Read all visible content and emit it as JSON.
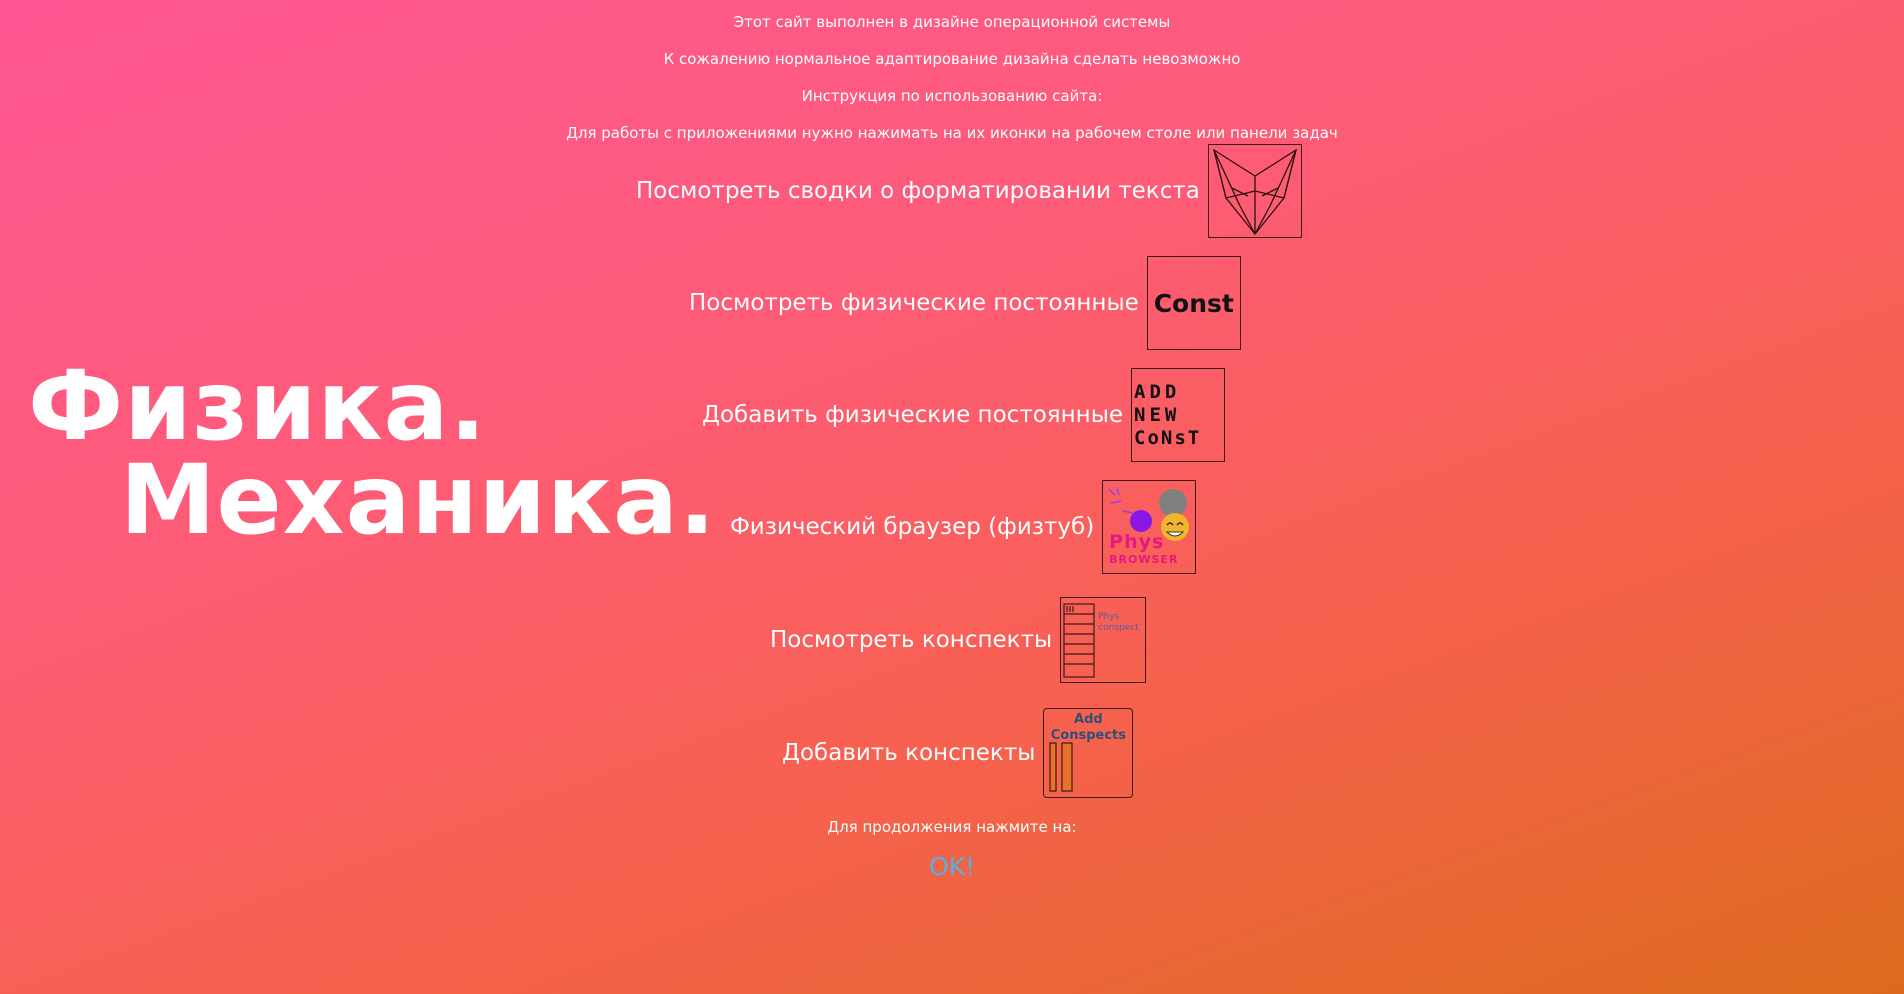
{
  "intro": {
    "line1": "Этот сайт выполнен в дизайне операционной системы",
    "line2": "К сожалению нормальное адаптирование дизайна сделать невозможно",
    "line3": "Инструкция по использованию сайта:",
    "line4": "Для работы с приложениями нужно нажимать на их иконки на рабочем столе или панели задач"
  },
  "hero": {
    "line1": "Физика.",
    "line2": "Механика."
  },
  "apps": [
    {
      "label": "Посмотреть сводки о форматировании текста",
      "icon": "fox-logo-icon"
    },
    {
      "label": "Посмотреть физические постоянные",
      "icon": "const-icon",
      "icon_text": "Const"
    },
    {
      "label": "Добавить физические постоянные",
      "icon": "add-new-const-icon",
      "icon_lines": [
        "ADD",
        "NEW",
        "CoNsT"
      ]
    },
    {
      "label": "Физический браузер (физтуб)",
      "icon": "phys-browser-icon",
      "icon_lines": [
        "Phys",
        "BROWSER"
      ]
    },
    {
      "label": "Посмотреть конспекты",
      "icon": "phys-conspect-icon",
      "icon_lines": [
        "Phys",
        "conspect"
      ]
    },
    {
      "label": "Добавить конспекты",
      "icon": "add-conspects-icon",
      "icon_lines": [
        "Add",
        "Conspects"
      ]
    }
  ],
  "footer": {
    "continue_text": "Для продолжения нажмите на:",
    "ok_label": "OK!"
  },
  "colors": {
    "gradient_start": "#ff5694",
    "gradient_end": "#dc6a1d",
    "ok_link": "#4fb4e0"
  }
}
